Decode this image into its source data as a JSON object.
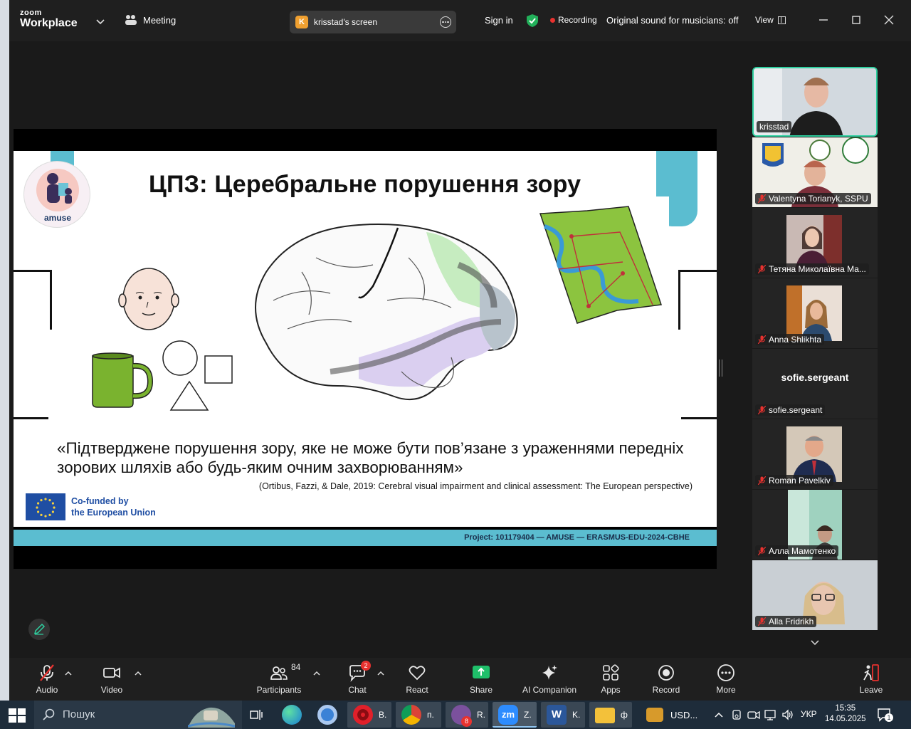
{
  "app": {
    "brand_top": "zoom",
    "brand_bottom": "Workplace",
    "meeting_label": "Meeting",
    "share_initial": "K",
    "share_label": "krisstad's screen",
    "sign_in": "Sign in",
    "recording_label": "Recording",
    "original_sound": "Original sound for musicians: off",
    "view_label": "View"
  },
  "slide": {
    "title": "ЦПЗ: Церебральне порушення зору",
    "logo_text": "amuse",
    "quote": "«Підтверджене порушення зору, яке не може бути пов’язане з ураженнями передніх зорових шляхів або будь-яким очним захворюванням»",
    "citation": "(Ortibus, Fazzi, & Dale, 2019: Cerebral visual impairment and clinical assessment: The European perspective)",
    "eu_line1": "Co-funded by",
    "eu_line2": "the European Union",
    "project": "Project: 101179404 — AMUSE — ERASMUS-EDU-2024-CBHE"
  },
  "participants": [
    {
      "name": "krisstad"
    },
    {
      "name": "Valentyna Torianyk, SSPU"
    },
    {
      "name": "Тетяна Миколаївна Ма..."
    },
    {
      "name": "Anna Shlikhta"
    },
    {
      "name": "sofie.sergeant"
    },
    {
      "name": "Roman Pavelkiv"
    },
    {
      "name": "Алла Мамотенко"
    },
    {
      "name": "Alla Fridrikh"
    }
  ],
  "toolbar": {
    "audio": "Audio",
    "video": "Video",
    "participants": "Participants",
    "participants_count": "84",
    "chat": "Chat",
    "chat_badge": "2",
    "react": "React",
    "share": "Share",
    "ai": "AI Companion",
    "apps": "Apps",
    "record": "Record",
    "more": "More",
    "leave": "Leave"
  },
  "taskbar": {
    "search": "Пошук",
    "apps": [
      {
        "label": "B."
      },
      {
        "label": "п."
      },
      {
        "label": "R.",
        "badge": "8"
      },
      {
        "label": "Z."
      },
      {
        "label": "K."
      },
      {
        "label": "ф"
      }
    ],
    "currency": "USD...",
    "language": "УКР",
    "time": "15:35",
    "date": "14.05.2025",
    "notif_count": "1"
  },
  "colors": {
    "accent_teal": "#5bbdd0",
    "speaker_border": "#2fd0a0",
    "recording_red": "#e8322f",
    "share_green": "#1fbf6a"
  }
}
